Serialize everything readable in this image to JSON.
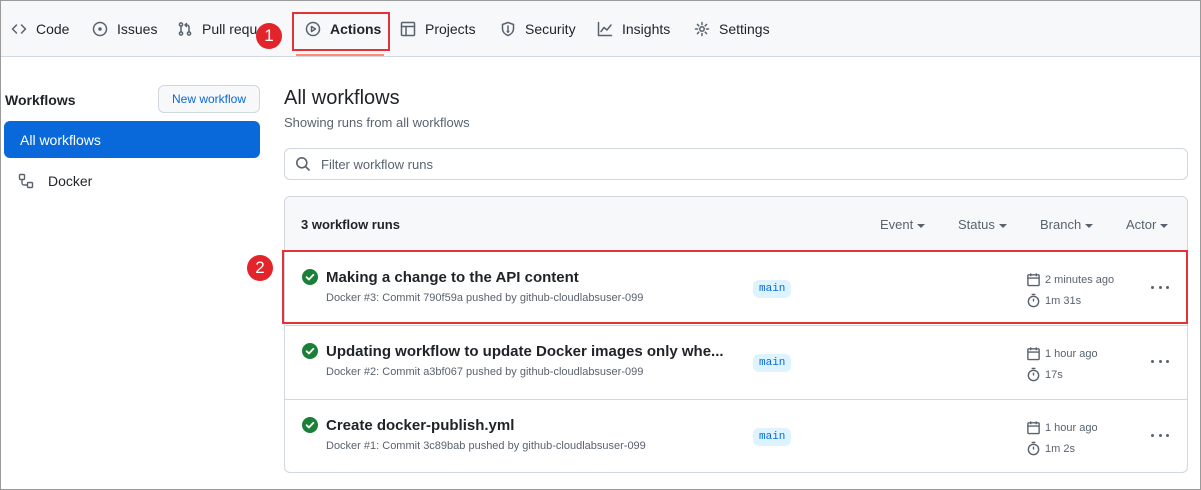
{
  "colors": {
    "accent": "#0969da",
    "success": "#1a7f37",
    "highlight": "#e53238",
    "active_tab_underline": "#fd8c73"
  },
  "nav": {
    "tabs": [
      {
        "label": "Code",
        "icon": "code-icon"
      },
      {
        "label": "Issues",
        "icon": "issue-opened-icon"
      },
      {
        "label": "Pull requ",
        "icon": "git-pull-request-icon"
      },
      {
        "label": "Actions",
        "icon": "play-icon",
        "active": true
      },
      {
        "label": "Projects",
        "icon": "table-icon"
      },
      {
        "label": "Security",
        "icon": "shield-icon"
      },
      {
        "label": "Insights",
        "icon": "graph-icon"
      },
      {
        "label": "Settings",
        "icon": "gear-icon"
      }
    ]
  },
  "callouts": [
    "1",
    "2"
  ],
  "sidebar": {
    "title": "Workflows",
    "new_workflow": "New workflow",
    "items": [
      {
        "label": "All workflows",
        "active": true
      },
      {
        "label": "Docker",
        "icon": "workflow-icon"
      }
    ]
  },
  "main": {
    "title": "All workflows",
    "subtitle": "Showing runs from all workflows",
    "filter_placeholder": "Filter workflow runs",
    "runs_header": {
      "count": "3 workflow runs",
      "filters": [
        "Event",
        "Status",
        "Branch",
        "Actor"
      ]
    },
    "runs": [
      {
        "title": "Making a change to the API content",
        "meta": "Docker #3: Commit 790f59a pushed by github-cloudlabsuser-099",
        "branch": "main",
        "when": "2 minutes ago",
        "duration": "1m 31s",
        "status": "success"
      },
      {
        "title": "Updating workflow to update Docker images only whe...",
        "meta": "Docker #2: Commit a3bf067 pushed by github-cloudlabsuser-099",
        "branch": "main",
        "when": "1 hour ago",
        "duration": "17s",
        "status": "success"
      },
      {
        "title": "Create docker-publish.yml",
        "meta": "Docker #1: Commit 3c89bab pushed by github-cloudlabsuser-099",
        "branch": "main",
        "when": "1 hour ago",
        "duration": "1m 2s",
        "status": "success"
      }
    ]
  }
}
